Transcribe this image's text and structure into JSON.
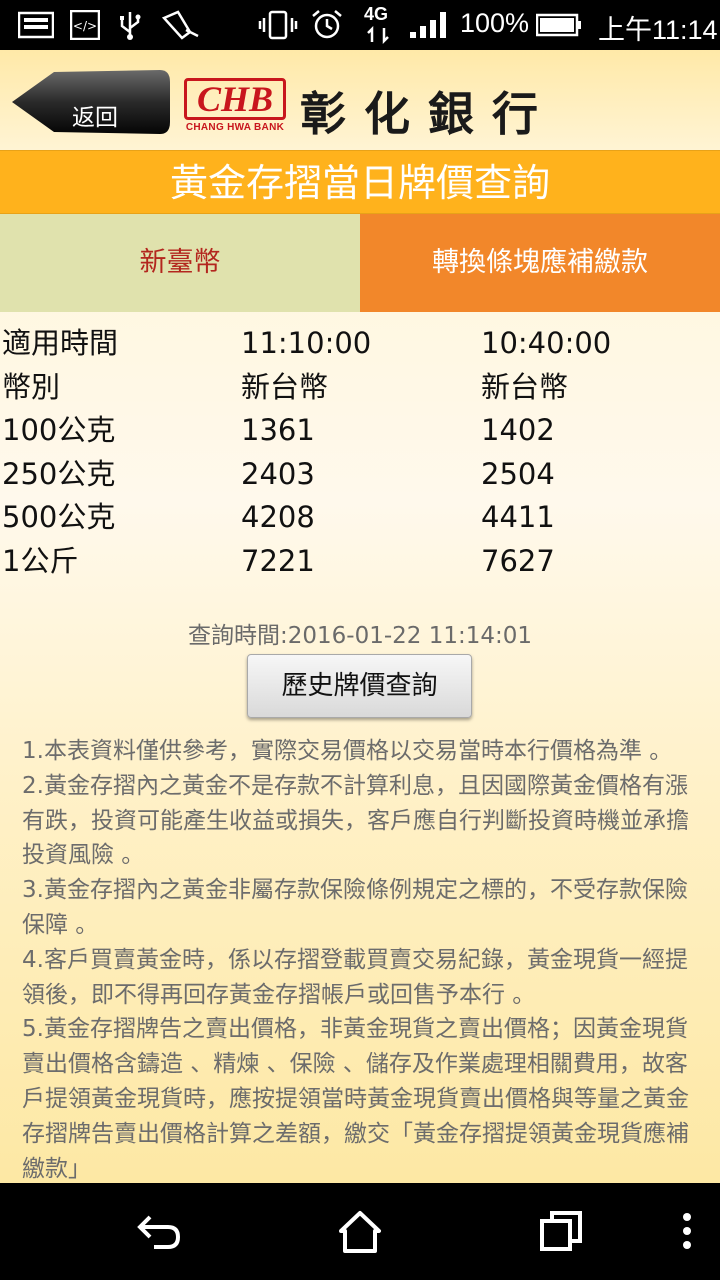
{
  "status_bar": {
    "network": "4G",
    "battery": "100%",
    "time": "上午11:14"
  },
  "header": {
    "back_label": "返回",
    "logo_text": "CHB",
    "logo_sub": "CHANG HWA BANK",
    "bank_name": "彰化銀行"
  },
  "page_title": "黃金存摺當日牌價查詢",
  "tabs": [
    {
      "label": "新臺幣"
    },
    {
      "label": "轉換條塊應補繳款"
    }
  ],
  "price_table": {
    "rows": [
      [
        "適用時間",
        "11:10:00",
        "10:40:00"
      ],
      [
        "幣別",
        "新台幣",
        "新台幣"
      ],
      [
        "100公克",
        "1361",
        "1402"
      ],
      [
        "250公克",
        "2403",
        "2504"
      ],
      [
        "500公克",
        "4208",
        "4411"
      ],
      [
        "1公斤",
        "7221",
        "7627"
      ]
    ]
  },
  "query_time": "查詢時間:2016-01-22 11:14:01",
  "history_button": "歷史牌價查詢",
  "notes": [
    "1.本表資料僅供參考，實際交易價格以交易當時本行價格為準 。",
    "2.黃金存摺內之黃金不是存款不計算利息，且因國際黃金價格有漲有跌，投資可能產生收益或損失，客戶應自行判斷投資時機並承擔投資風險 。",
    "3.黃金存摺內之黃金非屬存款保險條例規定之標的，不受存款保險保障 。",
    "4.客戶買賣黃金時，係以存摺登載買賣交易紀錄，黃金現貨一經提領後，即不得再回存黃金存摺帳戶或回售予本行 。",
    "5.黃金存摺牌告之賣出價格，非黃金現貨之賣出價格；因黃金現貨賣出價格含鑄造 、精煉 、保險 、儲存及作業處理相關費用，故客戶提領黃金現貨時，應按提領當時黃金現貨賣出價格與等量之黃金存摺牌告賣出價格計算之差額，繳交「黃金存摺提領黃金現貨應補繳款」"
  ],
  "colors": {
    "title_bar": "#ffb21c",
    "tab_active": "#e0e2ad",
    "tab_inactive": "#f2872a",
    "brand_red": "#c8161d"
  }
}
